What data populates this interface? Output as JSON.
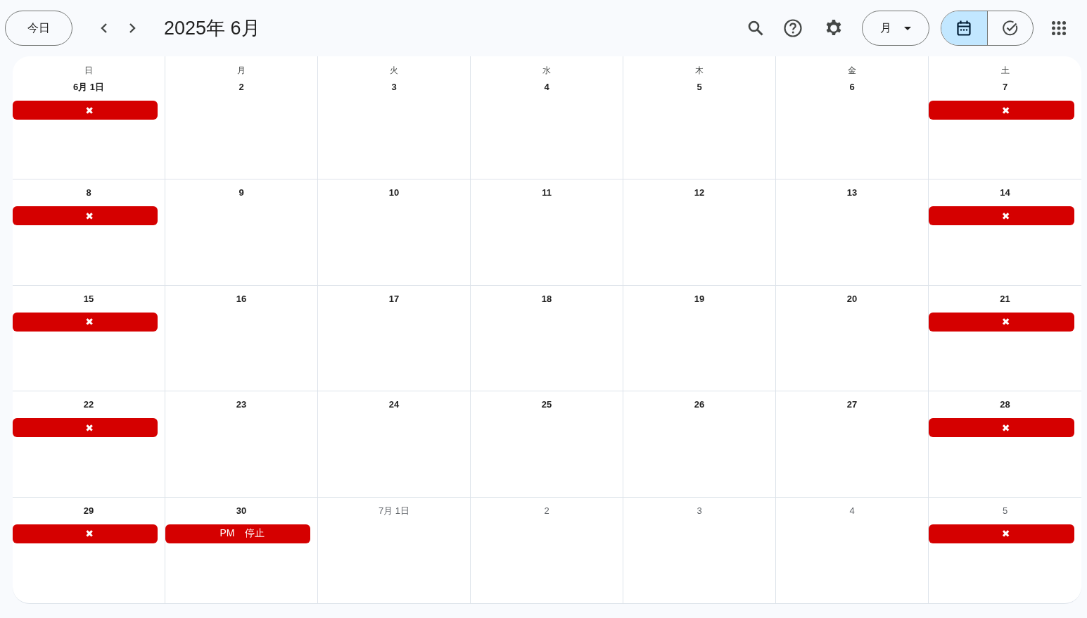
{
  "header": {
    "today_button": "今日",
    "title": "2025年 6月",
    "view_dropdown": "月",
    "view_switch": [
      {
        "kind": "calendar",
        "selected": true
      },
      {
        "kind": "tasks",
        "selected": false
      }
    ]
  },
  "calendar": {
    "weekdays": [
      "日",
      "月",
      "火",
      "水",
      "木",
      "金",
      "土"
    ],
    "weeks": [
      {
        "days": [
          {
            "date": "6月 1日",
            "outside_month": false,
            "events": [
              {
                "label": "✖"
              }
            ]
          },
          {
            "date": "2",
            "outside_month": false
          },
          {
            "date": "3",
            "outside_month": false
          },
          {
            "date": "4",
            "outside_month": false
          },
          {
            "date": "5",
            "outside_month": false
          },
          {
            "date": "6",
            "outside_month": false
          },
          {
            "date": "7",
            "outside_month": false,
            "events": [
              {
                "label": "✖"
              }
            ]
          }
        ]
      },
      {
        "days": [
          {
            "date": "8",
            "outside_month": false,
            "events": [
              {
                "label": "✖"
              }
            ]
          },
          {
            "date": "9",
            "outside_month": false
          },
          {
            "date": "10",
            "outside_month": false
          },
          {
            "date": "11",
            "outside_month": false
          },
          {
            "date": "12",
            "outside_month": false
          },
          {
            "date": "13",
            "outside_month": false
          },
          {
            "date": "14",
            "outside_month": false,
            "events": [
              {
                "label": "✖"
              }
            ]
          }
        ]
      },
      {
        "days": [
          {
            "date": "15",
            "outside_month": false,
            "events": [
              {
                "label": "✖"
              }
            ]
          },
          {
            "date": "16",
            "outside_month": false
          },
          {
            "date": "17",
            "outside_month": false
          },
          {
            "date": "18",
            "outside_month": false
          },
          {
            "date": "19",
            "outside_month": false
          },
          {
            "date": "20",
            "outside_month": false
          },
          {
            "date": "21",
            "outside_month": false,
            "events": [
              {
                "label": "✖"
              }
            ]
          }
        ]
      },
      {
        "days": [
          {
            "date": "22",
            "outside_month": false,
            "events": [
              {
                "label": "✖"
              }
            ]
          },
          {
            "date": "23",
            "outside_month": false
          },
          {
            "date": "24",
            "outside_month": false
          },
          {
            "date": "25",
            "outside_month": false
          },
          {
            "date": "26",
            "outside_month": false
          },
          {
            "date": "27",
            "outside_month": false
          },
          {
            "date": "28",
            "outside_month": false,
            "events": [
              {
                "label": "✖"
              }
            ]
          }
        ]
      },
      {
        "days": [
          {
            "date": "29",
            "outside_month": false,
            "events": [
              {
                "label": "✖"
              }
            ]
          },
          {
            "date": "30",
            "outside_month": false,
            "events": [
              {
                "label": "PM　停止"
              }
            ]
          },
          {
            "date": "7月 1日",
            "outside_month": true
          },
          {
            "date": "2",
            "outside_month": true
          },
          {
            "date": "3",
            "outside_month": true
          },
          {
            "date": "4",
            "outside_month": true
          },
          {
            "date": "5",
            "outside_month": true,
            "events": [
              {
                "label": "✖"
              }
            ]
          }
        ]
      }
    ]
  }
}
